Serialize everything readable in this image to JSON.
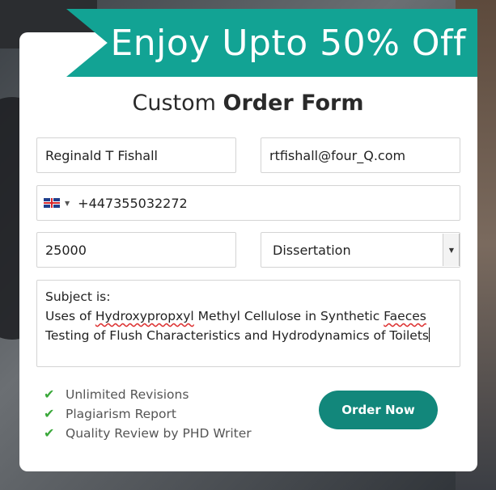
{
  "banner": {
    "text": "Enjoy Upto 50% Off"
  },
  "form": {
    "title_light": "Custom ",
    "title_bold": "Order Form",
    "name_value": "Reginald T Fishall",
    "email_value": "rtfishall@four_Q.com",
    "phone_country_icon": "uk-flag-icon",
    "phone_value": "+447355032272",
    "pages_value": "25000",
    "type_selected": "Dissertation",
    "subject_line1": "Subject is:",
    "subject_line2_a": "Uses of ",
    "subject_line2_b": "Hydroxypropxyl",
    "subject_line2_c": " Methyl Cellulose in Synthetic ",
    "subject_line2_d": "Faeces",
    "subject_line3": "Testing of Flush Characteristics and Hydrodynamics of Toilets"
  },
  "features": [
    {
      "icon": "check-icon",
      "label": "Unlimited Revisions"
    },
    {
      "icon": "check-icon",
      "label": "Plagiarism Report"
    },
    {
      "icon": "check-icon",
      "label": "Quality Review by PHD Writer"
    }
  ],
  "order_button": {
    "label": "Order Now"
  },
  "colors": {
    "accent": "#12a394",
    "button": "#12877b",
    "check": "#3aa83a"
  }
}
